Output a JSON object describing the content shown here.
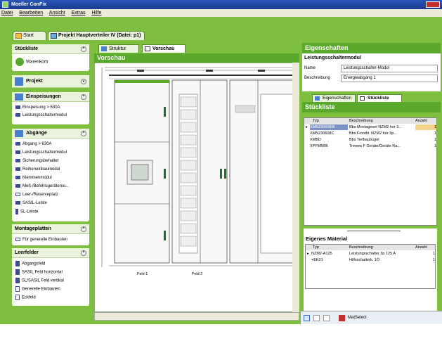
{
  "window": {
    "title": "Moeller ConFix"
  },
  "menu": [
    "Datei",
    "Bearbeiten",
    "Ansicht",
    "Extras",
    "Hilfe"
  ],
  "tabs": {
    "start": "Start",
    "project": "Projekt Hauptverteiler IV (Datei: p1)"
  },
  "left": {
    "stueckliste": {
      "title": "Stückliste",
      "items": [
        "Warenkorb"
      ]
    },
    "projekt": {
      "title": "Projekt"
    },
    "einspeisungen": {
      "title": "Einspeisungen",
      "items": [
        "Einspeisung > 630A",
        "Leistungsschaltermodul"
      ]
    },
    "abgaenge": {
      "title": "Abgänge",
      "items": [
        "Abgang > 630A",
        "Leistungsschaltermodul",
        "Sicherungsbehaltet",
        "Reiheneinbaumodul",
        "Klemmenmodul",
        "Meß-/Befehlsgerätemo...",
        "Leer-/Reserveplatz",
        "SASIL-Leiste",
        "SL-Leiste"
      ]
    },
    "montageplatten": {
      "title": "Montageplatten",
      "items": [
        "Für generelle Einbauten"
      ]
    },
    "leerfelder": {
      "title": "Leerfelder",
      "items": [
        "Abgangsfeld",
        "SASIL Feld horizontal",
        "SL/SASIL Feld vertikal",
        "Generelle Einbauten",
        "Eckfeld"
      ]
    }
  },
  "center": {
    "subtabs": [
      "Struktur",
      "Vorschau"
    ],
    "title": "Vorschau",
    "fields": [
      "Feld 1",
      "Feld 2"
    ]
  },
  "right": {
    "eigenschaften": "Eigenschaften",
    "module_title": "Leistungsschaltermodul",
    "name_label": "Name",
    "name_value": "Leistungsschalter-Modul",
    "besch_label": "Beschreibung",
    "besch_value": "Energieabgang 1",
    "tabs": [
      "Eigenschaften",
      "Stückliste"
    ],
    "stueckliste_title": "Stückliste",
    "cols": [
      "Typ",
      "Beschreibung",
      "Anzahl"
    ],
    "rows": [
      {
        "typ": "XMN230608M",
        "beschreibung": "Bbs Montageset NZM2 hor 3...",
        "anzahl": "1"
      },
      {
        "typ": "XMN230608C",
        "beschreibung": "Bbs Frontbl. NZM2 hor 3p...",
        "anzahl": "1"
      },
      {
        "typ": "XMBD",
        "beschreibung": "Bbs Tiefbaubügel",
        "anzahl": "1"
      },
      {
        "typ": "XPFMM06",
        "beschreibung": "Trennw F Geräte/Geräte Ra...",
        "anzahl": "1"
      }
    ],
    "eigenes_title": "Eigenes Material",
    "eig_cols": [
      "Typ",
      "Beschreibung",
      "Anzahl"
    ],
    "eig_rows": [
      {
        "typ": "NZM2-A125",
        "beschreibung": "Leistungsschalter 3p 125 A",
        "anzahl": "1"
      },
      {
        "typ": "+EK01",
        "beschreibung": "Hilfsschalterk. 1Ö",
        "anzahl": "1"
      }
    ],
    "matselect": "MatSelect"
  }
}
